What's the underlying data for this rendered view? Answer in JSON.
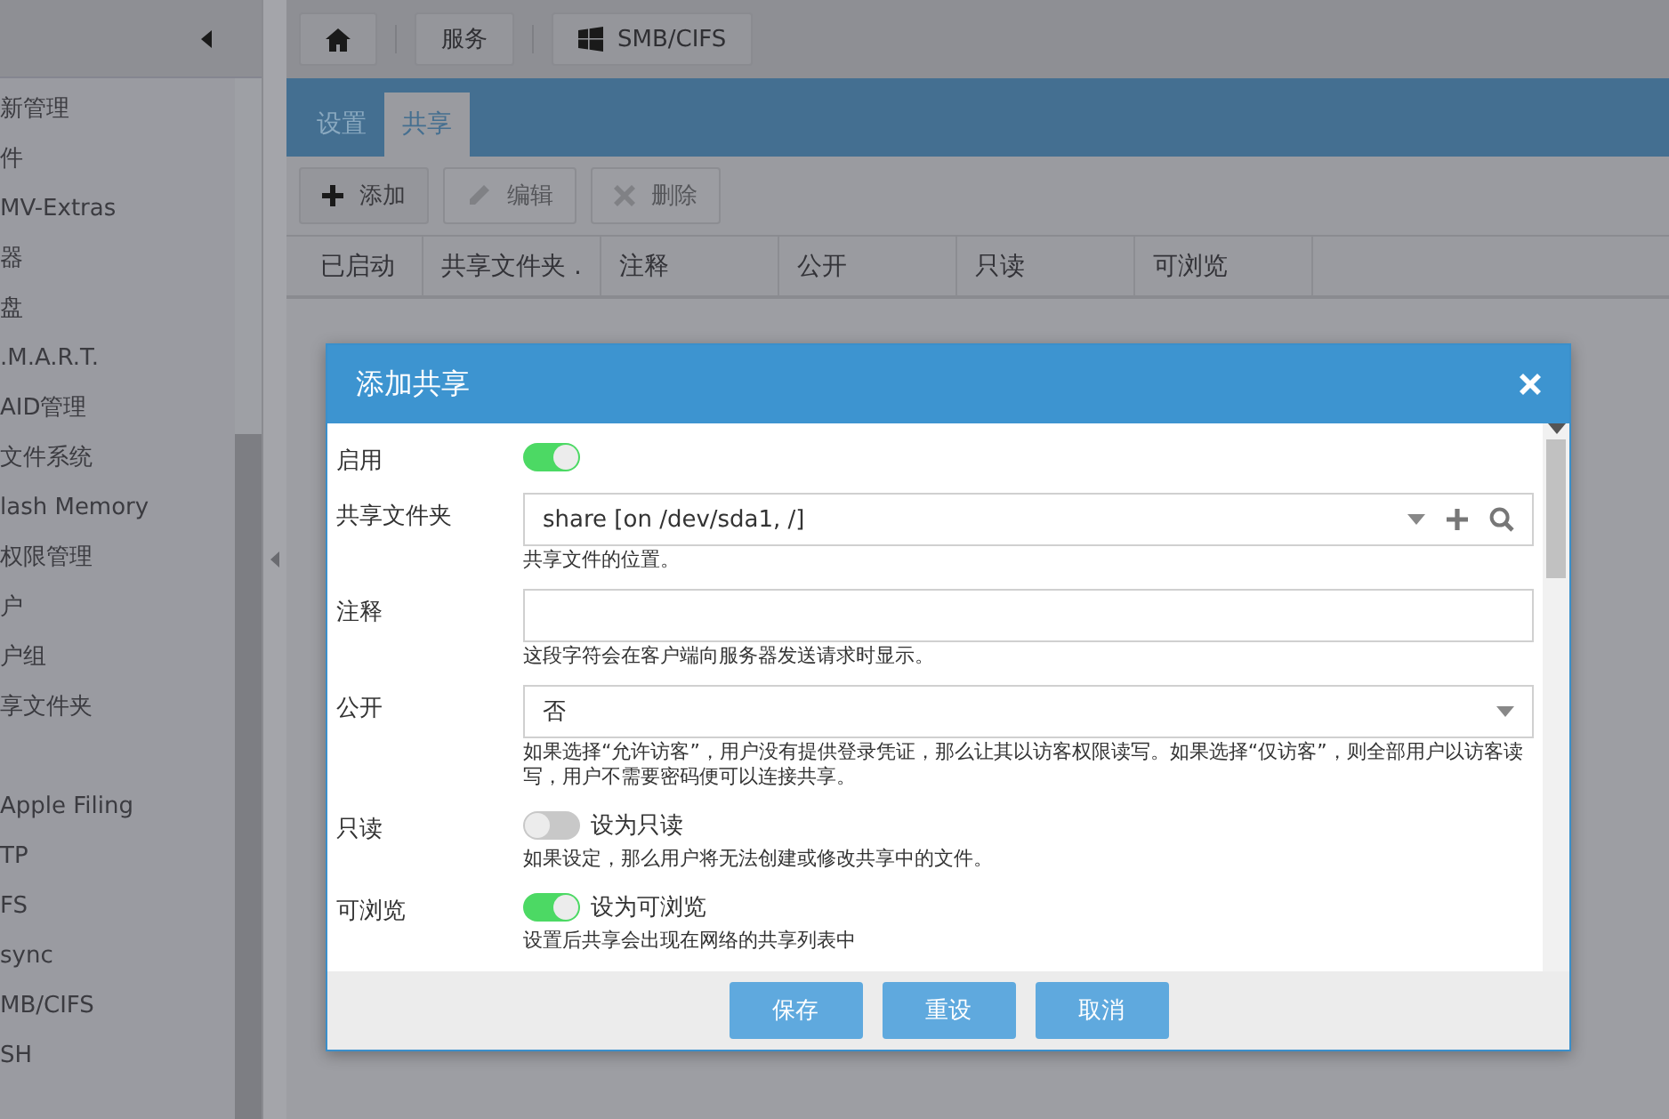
{
  "sidebar": {
    "groups": [
      {
        "items": [
          {
            "label": "新管理"
          },
          {
            "label": "件"
          },
          {
            "label": "MV-Extras"
          },
          {
            "label": "器"
          },
          {
            "label": "盘"
          },
          {
            "label": ".M.A.R.T."
          },
          {
            "label": "AID管理"
          },
          {
            "label": "文件系统"
          },
          {
            "label": "lash Memory"
          },
          {
            "label": "权限管理"
          },
          {
            "label": "户"
          },
          {
            "label": "户组"
          },
          {
            "label": "享文件夹"
          }
        ]
      },
      {
        "items": [
          {
            "label": "Apple Filing"
          },
          {
            "label": "TP"
          },
          {
            "label": "FS"
          },
          {
            "label": "sync"
          },
          {
            "label": "MB/CIFS"
          },
          {
            "label": "SH"
          }
        ]
      }
    ]
  },
  "breadcrumb": [
    {
      "kind": "home"
    },
    {
      "kind": "text",
      "label": "服务"
    },
    {
      "kind": "windows",
      "label": "SMB/CIFS"
    }
  ],
  "tabs": [
    {
      "label": "设置",
      "selected": false
    },
    {
      "label": "共享",
      "selected": true
    }
  ],
  "toolbar": [
    {
      "kind": "add",
      "label": "添加",
      "disabled": false
    },
    {
      "kind": "edit",
      "label": "编辑",
      "disabled": true
    },
    {
      "kind": "delete",
      "label": "删除",
      "disabled": true
    }
  ],
  "table": {
    "columns": [
      "已启动",
      "共享文件夹 .",
      "注释",
      "公开",
      "只读",
      "可浏览"
    ]
  },
  "dialog": {
    "title": "添加共享",
    "fields": [
      {
        "kind": "toggle",
        "label": "启用",
        "on": true
      },
      {
        "kind": "select",
        "label": "共享文件夹",
        "value": "share [on /dev/sda1, /]",
        "actions": true,
        "hint": "共享文件的位置。"
      },
      {
        "kind": "text",
        "label": "注释",
        "hint": "这段字符会在客户端向服务器发送请求时显示。"
      },
      {
        "kind": "select",
        "label": "公开",
        "value": "否",
        "actions": false,
        "hint": "如果选择“允许访客”，用户没有提供登录凭证，那么让其以访客权限读写。如果选择“仅访客”，则全部用户以访客读写，用户不需要密码便可以连接共享。"
      },
      {
        "kind": "toggle",
        "label": "只读",
        "on": false,
        "text": "设为只读",
        "hint": "如果设定，那么用户将无法创建或修改共享中的文件。"
      },
      {
        "kind": "toggle",
        "label": "可浏览",
        "on": true,
        "text": "设为可浏览",
        "hint": "设置后共享会出现在网络的共享列表中"
      }
    ],
    "buttons": [
      "保存",
      "重设",
      "取消"
    ]
  }
}
